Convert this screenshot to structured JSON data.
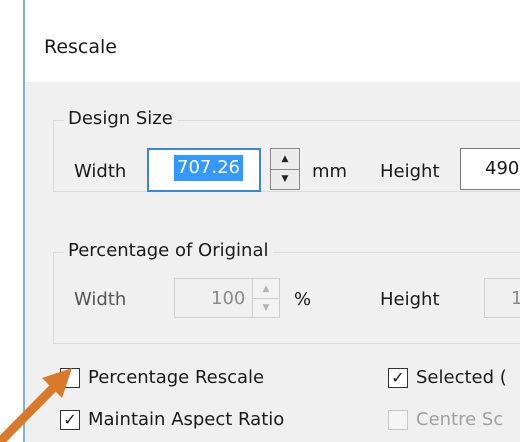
{
  "dialog": {
    "title": "Rescale"
  },
  "design_size": {
    "legend": "Design Size",
    "width_label": "Width",
    "width_value": "707.26",
    "unit": "mm",
    "height_label": "Height",
    "height_value": "490"
  },
  "percentage": {
    "legend": "Percentage of Original",
    "width_label": "Width",
    "width_value": "100",
    "unit": "%",
    "height_label": "Height",
    "height_value": "1"
  },
  "checkboxes": {
    "percentage_rescale": {
      "label": "Percentage Rescale",
      "checked": false
    },
    "maintain_aspect": {
      "label": "Maintain Aspect Ratio",
      "checked": true
    },
    "selected": {
      "label": "Selected (",
      "checked": true
    },
    "centre": {
      "label": "Centre Sc",
      "checked": false,
      "enabled": false
    }
  },
  "colors": {
    "selection": "#3399ff",
    "focus_border": "#3b86d6",
    "annotation_arrow": "#d97a2b"
  },
  "icons": {
    "spin_up": "▲",
    "spin_down": "▼",
    "check": "✓"
  }
}
